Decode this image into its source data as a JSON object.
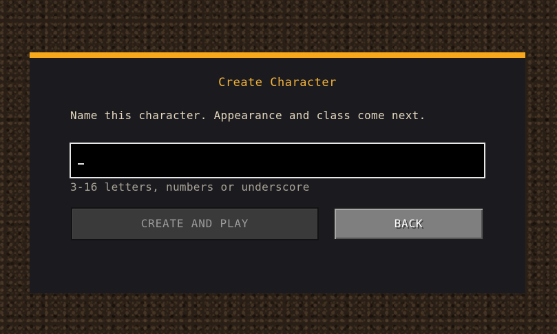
{
  "dialog": {
    "title": "Create Character",
    "description": "Name this character. Appearance and class come next.",
    "name_input": {
      "value": "",
      "placeholder": ""
    },
    "hint": "3-16 letters, numbers or underscore",
    "create_button_label": "CREATE AND PLAY",
    "back_button_label": "BACK"
  },
  "colors": {
    "accent": "#f7a81b",
    "title": "#f5b43a",
    "panel_bg": "#1a1a1f",
    "text": "#e6d9bf",
    "hint": "#a9a396",
    "button_disabled": "#3a3a3a",
    "button_active": "#7f7f7f"
  }
}
